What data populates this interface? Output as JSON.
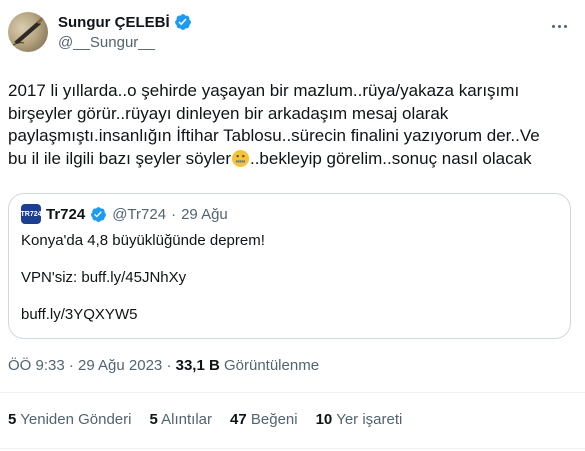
{
  "author": {
    "display_name": "Sungur ÇELEBİ",
    "handle": "@__Sungur__",
    "verified_icon": "verified-badge-icon"
  },
  "tweet": {
    "lines": [
      "2017 li yıllarda..o şehirde yaşayan bir mazlum..rüya/yakaza karışımı",
      "birşeyler görür..rüyayı dinleyen bir arkadaşım mesaj olarak",
      "paylaşmıştı.insanlığın İftihar Tablosu..sürecin finalini yazıyorum der..Ve",
      "bu il ile ilgili bazı şeyler söyler",
      "..bekleyip görelim..sonuç nasıl olacak"
    ],
    "emoji": "zipper-mouth-face"
  },
  "quote": {
    "avatar_text": "TR724",
    "name": "Tr724",
    "handle": "@Tr724",
    "separator": "·",
    "date": "29 Ağu",
    "text_line1": "Konya'da 4,8 büyüklüğünde deprem!",
    "text_line2": "VPN'siz: buff.ly/45JNhXy",
    "text_line3": "buff.ly/3YQXYW5"
  },
  "meta": {
    "time_date": "ÖÖ 9:33 · 29 Ağu 2023 · ",
    "views_count": "33,1 B",
    "views_label": " Görüntülenme"
  },
  "stats": {
    "retweets_count": "5",
    "retweets_label": "Yeniden Gönderi",
    "quotes_count": "5",
    "quotes_label": "Alıntılar",
    "likes_count": "47",
    "likes_label": "Beğeni",
    "bookmarks_count": "10",
    "bookmarks_label": "Yer işareti"
  },
  "colors": {
    "primary_text": "#0f1419",
    "secondary_text": "#536471",
    "verified_blue": "#1d9bf0",
    "border": "#cfd9de"
  }
}
